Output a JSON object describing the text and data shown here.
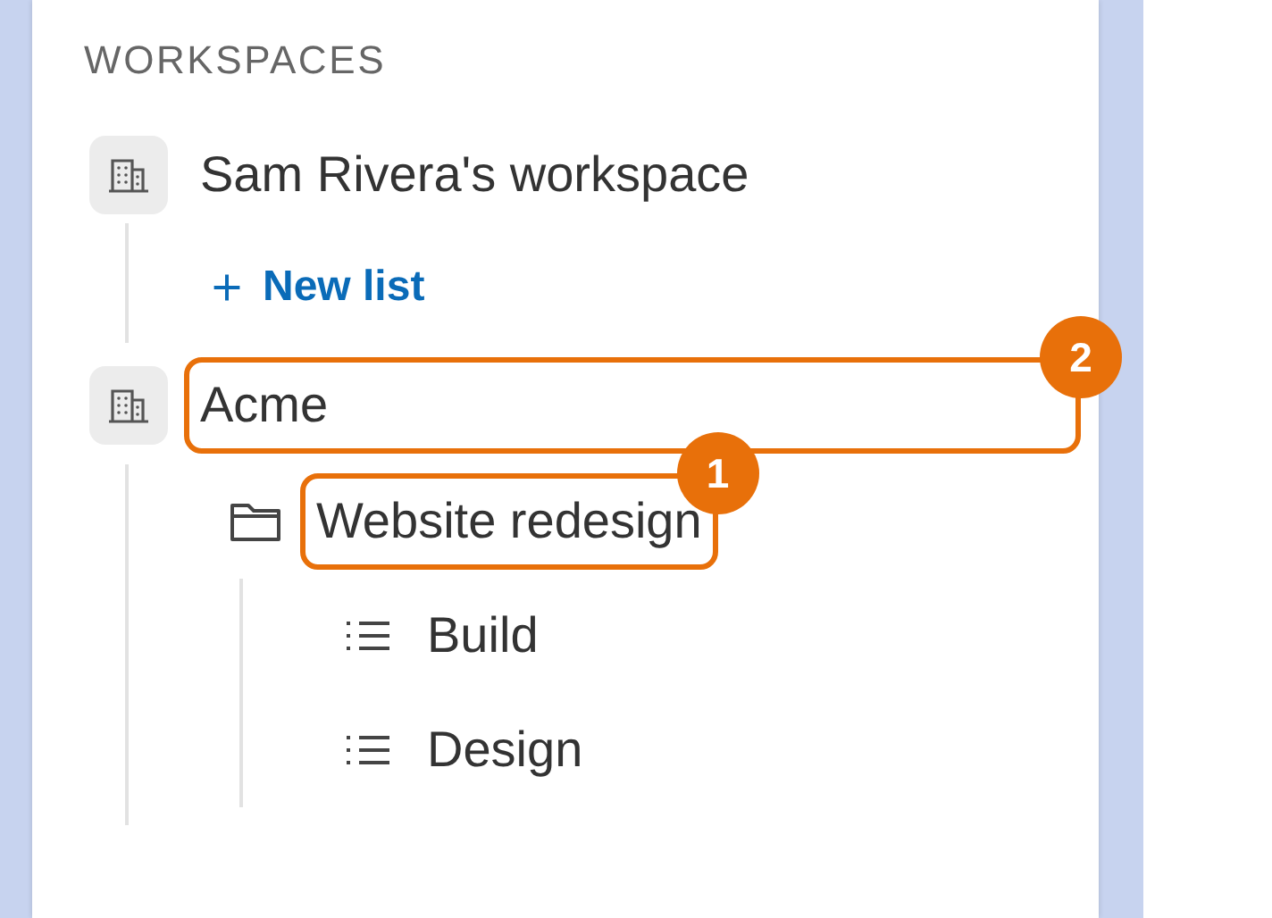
{
  "section_title": "WORKSPACES",
  "workspaces": [
    {
      "name": "Sam Rivera's workspace",
      "children": [
        {
          "kind": "action",
          "label": "New list"
        }
      ]
    },
    {
      "name": "Acme",
      "callout": "2",
      "children": [
        {
          "kind": "folder",
          "label": "Website redesign",
          "callout": "1",
          "children": [
            {
              "kind": "list",
              "label": "Build"
            },
            {
              "kind": "list",
              "label": "Design"
            }
          ]
        }
      ]
    }
  ]
}
